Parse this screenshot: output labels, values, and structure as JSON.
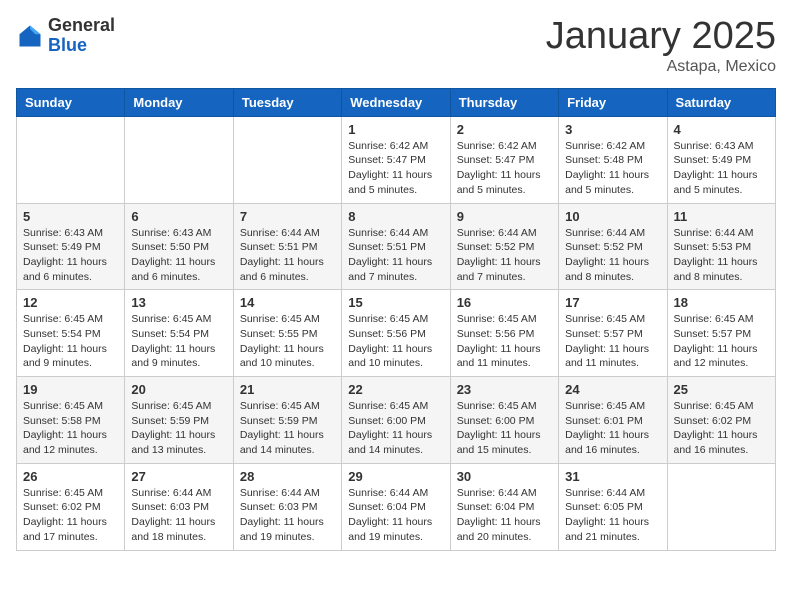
{
  "header": {
    "logo_general": "General",
    "logo_blue": "Blue",
    "month": "January 2025",
    "location": "Astapa, Mexico"
  },
  "weekdays": [
    "Sunday",
    "Monday",
    "Tuesday",
    "Wednesday",
    "Thursday",
    "Friday",
    "Saturday"
  ],
  "weeks": [
    [
      {
        "day": "",
        "info": ""
      },
      {
        "day": "",
        "info": ""
      },
      {
        "day": "",
        "info": ""
      },
      {
        "day": "1",
        "info": "Sunrise: 6:42 AM\nSunset: 5:47 PM\nDaylight: 11 hours and 5 minutes."
      },
      {
        "day": "2",
        "info": "Sunrise: 6:42 AM\nSunset: 5:47 PM\nDaylight: 11 hours and 5 minutes."
      },
      {
        "day": "3",
        "info": "Sunrise: 6:42 AM\nSunset: 5:48 PM\nDaylight: 11 hours and 5 minutes."
      },
      {
        "day": "4",
        "info": "Sunrise: 6:43 AM\nSunset: 5:49 PM\nDaylight: 11 hours and 5 minutes."
      }
    ],
    [
      {
        "day": "5",
        "info": "Sunrise: 6:43 AM\nSunset: 5:49 PM\nDaylight: 11 hours and 6 minutes."
      },
      {
        "day": "6",
        "info": "Sunrise: 6:43 AM\nSunset: 5:50 PM\nDaylight: 11 hours and 6 minutes."
      },
      {
        "day": "7",
        "info": "Sunrise: 6:44 AM\nSunset: 5:51 PM\nDaylight: 11 hours and 6 minutes."
      },
      {
        "day": "8",
        "info": "Sunrise: 6:44 AM\nSunset: 5:51 PM\nDaylight: 11 hours and 7 minutes."
      },
      {
        "day": "9",
        "info": "Sunrise: 6:44 AM\nSunset: 5:52 PM\nDaylight: 11 hours and 7 minutes."
      },
      {
        "day": "10",
        "info": "Sunrise: 6:44 AM\nSunset: 5:52 PM\nDaylight: 11 hours and 8 minutes."
      },
      {
        "day": "11",
        "info": "Sunrise: 6:44 AM\nSunset: 5:53 PM\nDaylight: 11 hours and 8 minutes."
      }
    ],
    [
      {
        "day": "12",
        "info": "Sunrise: 6:45 AM\nSunset: 5:54 PM\nDaylight: 11 hours and 9 minutes."
      },
      {
        "day": "13",
        "info": "Sunrise: 6:45 AM\nSunset: 5:54 PM\nDaylight: 11 hours and 9 minutes."
      },
      {
        "day": "14",
        "info": "Sunrise: 6:45 AM\nSunset: 5:55 PM\nDaylight: 11 hours and 10 minutes."
      },
      {
        "day": "15",
        "info": "Sunrise: 6:45 AM\nSunset: 5:56 PM\nDaylight: 11 hours and 10 minutes."
      },
      {
        "day": "16",
        "info": "Sunrise: 6:45 AM\nSunset: 5:56 PM\nDaylight: 11 hours and 11 minutes."
      },
      {
        "day": "17",
        "info": "Sunrise: 6:45 AM\nSunset: 5:57 PM\nDaylight: 11 hours and 11 minutes."
      },
      {
        "day": "18",
        "info": "Sunrise: 6:45 AM\nSunset: 5:57 PM\nDaylight: 11 hours and 12 minutes."
      }
    ],
    [
      {
        "day": "19",
        "info": "Sunrise: 6:45 AM\nSunset: 5:58 PM\nDaylight: 11 hours and 12 minutes."
      },
      {
        "day": "20",
        "info": "Sunrise: 6:45 AM\nSunset: 5:59 PM\nDaylight: 11 hours and 13 minutes."
      },
      {
        "day": "21",
        "info": "Sunrise: 6:45 AM\nSunset: 5:59 PM\nDaylight: 11 hours and 14 minutes."
      },
      {
        "day": "22",
        "info": "Sunrise: 6:45 AM\nSunset: 6:00 PM\nDaylight: 11 hours and 14 minutes."
      },
      {
        "day": "23",
        "info": "Sunrise: 6:45 AM\nSunset: 6:00 PM\nDaylight: 11 hours and 15 minutes."
      },
      {
        "day": "24",
        "info": "Sunrise: 6:45 AM\nSunset: 6:01 PM\nDaylight: 11 hours and 16 minutes."
      },
      {
        "day": "25",
        "info": "Sunrise: 6:45 AM\nSunset: 6:02 PM\nDaylight: 11 hours and 16 minutes."
      }
    ],
    [
      {
        "day": "26",
        "info": "Sunrise: 6:45 AM\nSunset: 6:02 PM\nDaylight: 11 hours and 17 minutes."
      },
      {
        "day": "27",
        "info": "Sunrise: 6:44 AM\nSunset: 6:03 PM\nDaylight: 11 hours and 18 minutes."
      },
      {
        "day": "28",
        "info": "Sunrise: 6:44 AM\nSunset: 6:03 PM\nDaylight: 11 hours and 19 minutes."
      },
      {
        "day": "29",
        "info": "Sunrise: 6:44 AM\nSunset: 6:04 PM\nDaylight: 11 hours and 19 minutes."
      },
      {
        "day": "30",
        "info": "Sunrise: 6:44 AM\nSunset: 6:04 PM\nDaylight: 11 hours and 20 minutes."
      },
      {
        "day": "31",
        "info": "Sunrise: 6:44 AM\nSunset: 6:05 PM\nDaylight: 11 hours and 21 minutes."
      },
      {
        "day": "",
        "info": ""
      }
    ]
  ]
}
